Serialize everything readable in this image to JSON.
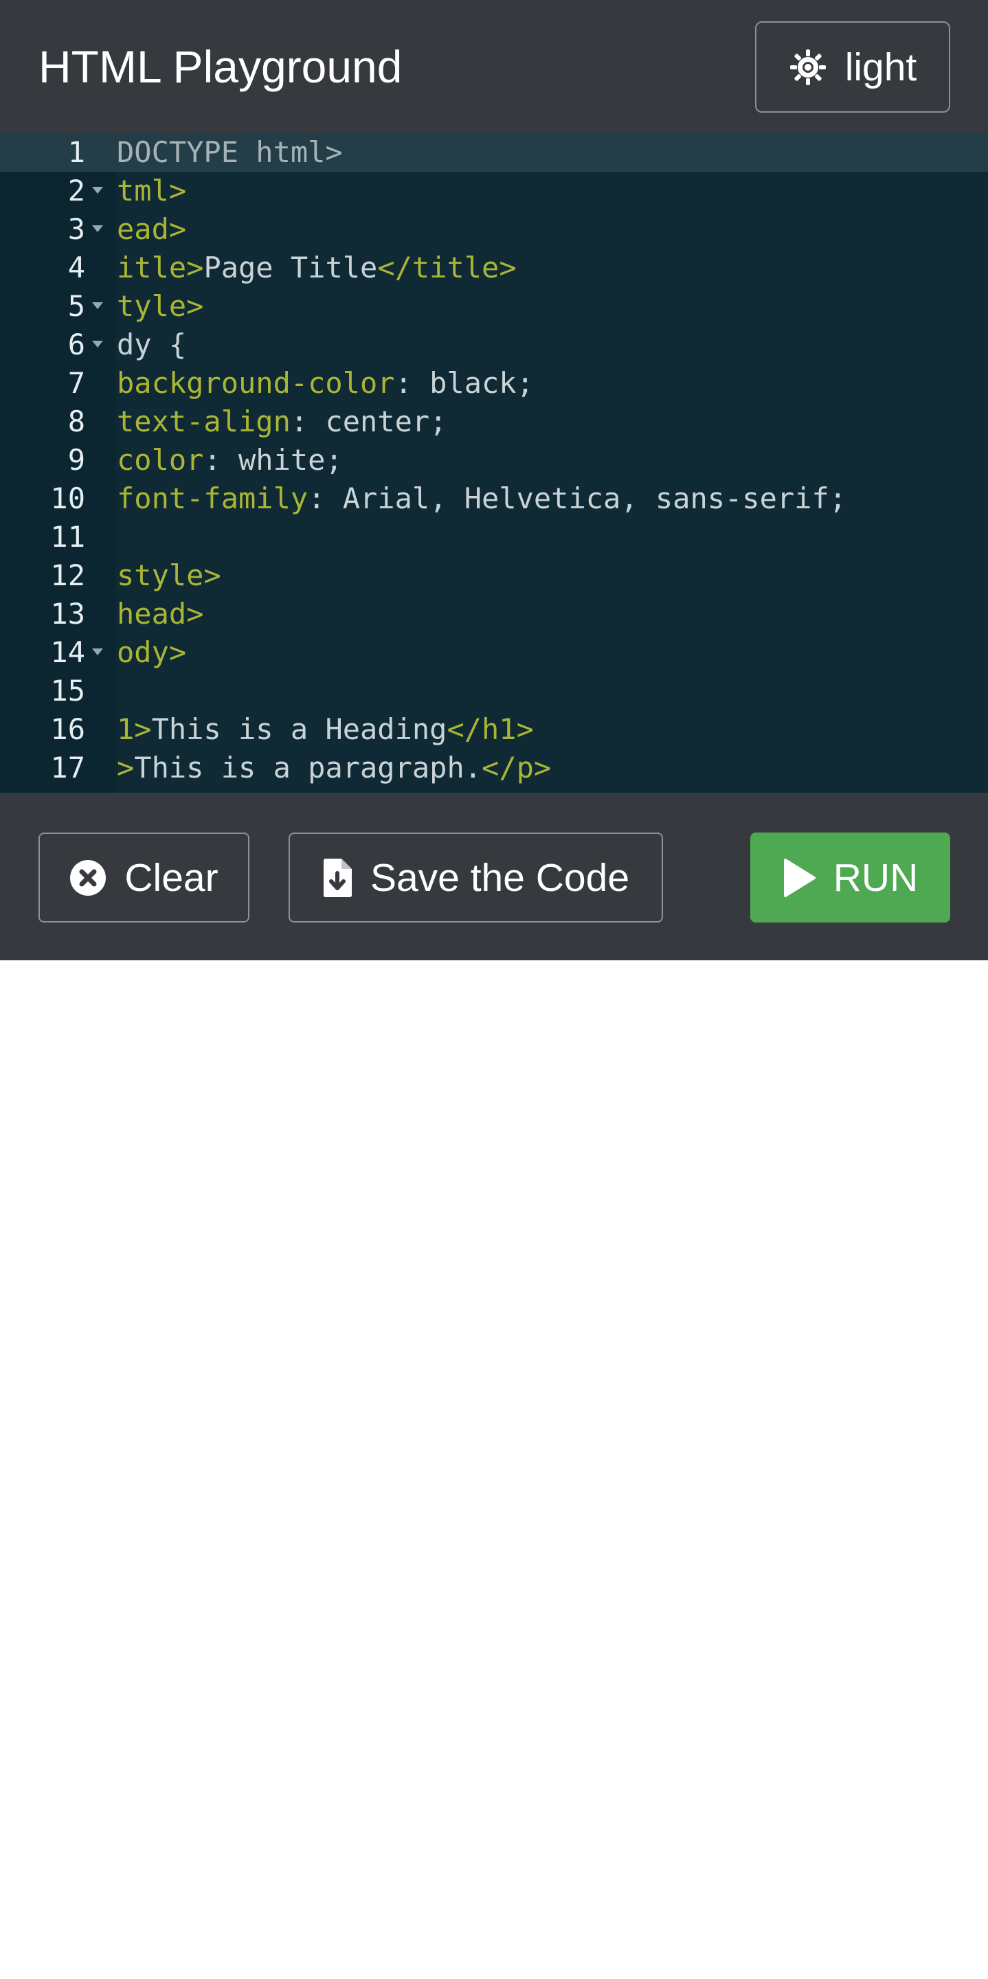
{
  "header": {
    "title": "HTML Playground",
    "theme_toggle_label": "light",
    "theme_toggle_icon": "sun-icon"
  },
  "editor": {
    "active_line": 1,
    "lines": [
      {
        "number": "1",
        "fold": false,
        "tokens": [
          {
            "t": "DOCTYPE html>",
            "c": "gray"
          }
        ]
      },
      {
        "number": "2",
        "fold": true,
        "tokens": [
          {
            "t": "tml>",
            "c": "tag"
          }
        ]
      },
      {
        "number": "3",
        "fold": true,
        "tokens": [
          {
            "t": "ead>",
            "c": "tag"
          }
        ]
      },
      {
        "number": "4",
        "fold": false,
        "tokens": [
          {
            "t": "itle>",
            "c": "tag"
          },
          {
            "t": "Page Title",
            "c": "text"
          },
          {
            "t": "</title>",
            "c": "tag"
          }
        ]
      },
      {
        "number": "5",
        "fold": true,
        "tokens": [
          {
            "t": "tyle>",
            "c": "tag"
          }
        ]
      },
      {
        "number": "6",
        "fold": true,
        "tokens": [
          {
            "t": "dy {",
            "c": "text"
          }
        ]
      },
      {
        "number": "7",
        "fold": false,
        "tokens": [
          {
            "t": "background-color",
            "c": "tag"
          },
          {
            "t": ": black;",
            "c": "text"
          }
        ]
      },
      {
        "number": "8",
        "fold": false,
        "tokens": [
          {
            "t": "text-align",
            "c": "tag"
          },
          {
            "t": ": center;",
            "c": "text"
          }
        ]
      },
      {
        "number": "9",
        "fold": false,
        "tokens": [
          {
            "t": "color",
            "c": "tag"
          },
          {
            "t": ": white;",
            "c": "text"
          }
        ]
      },
      {
        "number": "10",
        "fold": false,
        "tokens": [
          {
            "t": "font-family",
            "c": "tag"
          },
          {
            "t": ": Arial, Helvetica, sans-serif;",
            "c": "text"
          }
        ]
      },
      {
        "number": "11",
        "fold": false,
        "tokens": []
      },
      {
        "number": "12",
        "fold": false,
        "tokens": [
          {
            "t": "style>",
            "c": "tag"
          }
        ]
      },
      {
        "number": "13",
        "fold": false,
        "tokens": [
          {
            "t": "head>",
            "c": "tag"
          }
        ]
      },
      {
        "number": "14",
        "fold": true,
        "tokens": [
          {
            "t": "ody>",
            "c": "tag"
          }
        ]
      },
      {
        "number": "15",
        "fold": false,
        "tokens": []
      },
      {
        "number": "16",
        "fold": false,
        "tokens": [
          {
            "t": "1>",
            "c": "tag"
          },
          {
            "t": "This is a Heading",
            "c": "text"
          },
          {
            "t": "</h1>",
            "c": "tag"
          }
        ]
      },
      {
        "number": "17",
        "fold": false,
        "tokens": [
          {
            "t": ">",
            "c": "tag"
          },
          {
            "t": "This is a paragraph.",
            "c": "text"
          },
          {
            "t": "</p>",
            "c": "tag"
          }
        ]
      }
    ]
  },
  "footer": {
    "clear_label": "Clear",
    "clear_icon": "close-circle-icon",
    "save_label": "Save the Code",
    "save_icon": "file-download-icon",
    "run_label": "RUN",
    "run_icon": "play-icon"
  },
  "colors": {
    "header_bg": "#363a3e",
    "editor_bg": "#0f2a35",
    "tag": "#aab533",
    "text": "#c9d3d6",
    "run_button": "#4fa852"
  }
}
